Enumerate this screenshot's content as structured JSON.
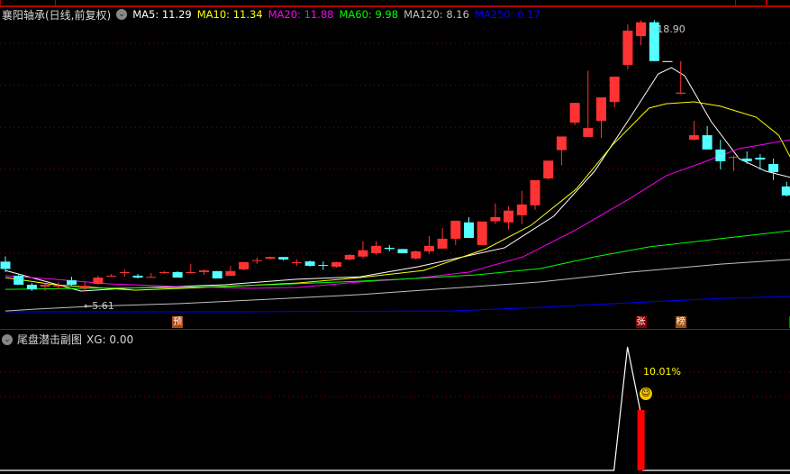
{
  "header": {
    "stock_title": "襄阳轴承(日线,前复权)",
    "ma_labels": [
      {
        "text": "MA5: 11.29",
        "color": "#ffffff"
      },
      {
        "text": "MA10: 11.34",
        "color": "#ffff00"
      },
      {
        "text": "MA20: 11.88",
        "color": "#ff00ff"
      },
      {
        "text": "MA60: 9.98",
        "color": "#00ff00"
      },
      {
        "text": "MA120: 8.16",
        "color": "#c0c0c0"
      },
      {
        "text": "MA250: 6.17",
        "color": "#0000ff"
      }
    ]
  },
  "main_chart": {
    "high_label": "18.90",
    "low_label": "5.61",
    "grid_prices": [
      18,
      16,
      14,
      12,
      10,
      8
    ],
    "price_range": [
      5.0,
      18.9
    ],
    "up_color": "#ff3333",
    "down_color": "#54ffff",
    "candles": [
      [
        7.6,
        7.25,
        7.85,
        7.1
      ],
      [
        6.93,
        6.5,
        7.01,
        6.5
      ],
      [
        6.5,
        6.28,
        6.58,
        6.2
      ],
      [
        6.41,
        6.5,
        6.58,
        6.2
      ],
      [
        6.45,
        6.45,
        6.62,
        6.28
      ],
      [
        6.71,
        6.5,
        6.88,
        6.45
      ],
      [
        6.33,
        6.45,
        6.62,
        6.2
      ],
      [
        6.54,
        6.84,
        6.93,
        6.5
      ],
      [
        6.9,
        6.93,
        7.01,
        6.88
      ],
      [
        7.08,
        7.1,
        7.23,
        6.88
      ],
      [
        6.93,
        6.84,
        7.01,
        6.8
      ],
      [
        6.85,
        6.87,
        7.06,
        6.84
      ],
      [
        7.06,
        7.1,
        7.15,
        7.01
      ],
      [
        7.1,
        6.84,
        7.15,
        6.84
      ],
      [
        7.06,
        7.1,
        7.49,
        7.01
      ],
      [
        7.1,
        7.18,
        7.23,
        6.97
      ],
      [
        7.15,
        6.8,
        7.15,
        6.8
      ],
      [
        6.93,
        7.15,
        7.4,
        6.93
      ],
      [
        7.23,
        7.58,
        7.58,
        7.19
      ],
      [
        7.65,
        7.67,
        7.8,
        7.49
      ],
      [
        7.74,
        7.82,
        7.84,
        7.7
      ],
      [
        7.82,
        7.7,
        7.82,
        7.65
      ],
      [
        7.55,
        7.57,
        7.7,
        7.4
      ],
      [
        7.61,
        7.4,
        7.65,
        7.36
      ],
      [
        7.44,
        7.42,
        7.62,
        7.2
      ],
      [
        7.36,
        7.57,
        7.6,
        7.32
      ],
      [
        7.7,
        7.92,
        7.95,
        7.66
      ],
      [
        7.84,
        8.14,
        8.57,
        7.75
      ],
      [
        8.0,
        8.35,
        8.57,
        7.92
      ],
      [
        8.26,
        8.2,
        8.39,
        8.09
      ],
      [
        8.2,
        8.0,
        8.2,
        8.0
      ],
      [
        7.75,
        8.09,
        8.13,
        7.7
      ],
      [
        8.09,
        8.35,
        8.82,
        7.97
      ],
      [
        8.22,
        8.69,
        9.2,
        8.22
      ],
      [
        8.69,
        9.55,
        9.55,
        8.39
      ],
      [
        9.47,
        8.73,
        9.72,
        8.73
      ],
      [
        8.39,
        9.51,
        9.51,
        8.39
      ],
      [
        9.52,
        9.72,
        10.37,
        9.39
      ],
      [
        9.47,
        10.03,
        10.24,
        9.13
      ],
      [
        9.81,
        10.32,
        10.97,
        9.39
      ],
      [
        10.28,
        11.48,
        11.48,
        10.07
      ],
      [
        11.56,
        12.41,
        12.41,
        11.5
      ],
      [
        12.91,
        13.56,
        13.56,
        12.19
      ],
      [
        14.22,
        15.16,
        15.16,
        14.1
      ],
      [
        13.54,
        13.96,
        16.69,
        13.54
      ],
      [
        14.3,
        15.42,
        15.42,
        13.49
      ],
      [
        15.2,
        16.41,
        16.41,
        14.96
      ],
      [
        16.97,
        18.6,
        18.9,
        16.75
      ],
      [
        18.34,
        19.0,
        19.1,
        17.9
      ],
      [
        19.0,
        17.15,
        19.1,
        17.15
      ],
      [
        17.15,
        17.15,
        17.15,
        17.15
      ],
      [
        15.6,
        15.65,
        17.15,
        15.6
      ],
      [
        13.41,
        13.62,
        14.3,
        13.37
      ],
      [
        13.62,
        12.94,
        14.05,
        12.94
      ],
      [
        12.94,
        12.38,
        13.4,
        12.0
      ],
      [
        12.59,
        12.59,
        12.65,
        11.91
      ],
      [
        12.51,
        12.38,
        12.85,
        12.25
      ],
      [
        12.55,
        12.46,
        12.72,
        11.97
      ],
      [
        12.25,
        11.86,
        12.51,
        11.48
      ],
      [
        11.18,
        10.75,
        11.4,
        10.7
      ]
    ],
    "ma_series": [
      {
        "name": "MA5",
        "color": "#ffffff",
        "points": [
          [
            0,
            7.18
          ],
          [
            5.7,
            6.2
          ],
          [
            9.1,
            6.33
          ],
          [
            16.6,
            6.5
          ],
          [
            22,
            6.76
          ],
          [
            26.8,
            6.88
          ],
          [
            31.2,
            7.36
          ],
          [
            34.3,
            7.79
          ],
          [
            37.7,
            8.26
          ],
          [
            41.4,
            9.76
          ],
          [
            44.5,
            11.91
          ],
          [
            47.2,
            14.48
          ],
          [
            49.3,
            16.54
          ],
          [
            50.3,
            16.84
          ],
          [
            51.3,
            16.45
          ],
          [
            53.3,
            14.27
          ],
          [
            55.4,
            12.51
          ],
          [
            57.4,
            11.91
          ],
          [
            59.3,
            11.61
          ]
        ]
      },
      {
        "name": "MA10",
        "color": "#ffff00",
        "points": [
          [
            0,
            6.84
          ],
          [
            3.7,
            6.5
          ],
          [
            9.8,
            6.24
          ],
          [
            16.6,
            6.41
          ],
          [
            22,
            6.58
          ],
          [
            26.8,
            6.84
          ],
          [
            31.6,
            7.18
          ],
          [
            36.3,
            8.21
          ],
          [
            39.7,
            9.33
          ],
          [
            43.1,
            11.05
          ],
          [
            45.9,
            13.19
          ],
          [
            48.6,
            14.91
          ],
          [
            49.9,
            15.12
          ],
          [
            52,
            15.21
          ],
          [
            54,
            15.0
          ],
          [
            56.7,
            14.48
          ],
          [
            58.4,
            13.62
          ],
          [
            59.3,
            12.55
          ]
        ]
      },
      {
        "name": "MA20",
        "color": "#ff00ff",
        "points": [
          [
            0,
            6.93
          ],
          [
            3.7,
            6.76
          ],
          [
            7.8,
            6.54
          ],
          [
            13.2,
            6.41
          ],
          [
            18.6,
            6.33
          ],
          [
            22,
            6.37
          ],
          [
            26.8,
            6.63
          ],
          [
            30.9,
            6.8
          ],
          [
            35,
            7.1
          ],
          [
            39.1,
            7.83
          ],
          [
            43.1,
            9.12
          ],
          [
            47.2,
            10.62
          ],
          [
            49.9,
            11.69
          ],
          [
            52.7,
            12.33
          ],
          [
            55.4,
            12.98
          ],
          [
            59.3,
            13.41
          ]
        ]
      },
      {
        "name": "MA60",
        "color": "#00ff00",
        "points": [
          [
            0,
            6.28
          ],
          [
            6.4,
            6.33
          ],
          [
            13.2,
            6.37
          ],
          [
            20,
            6.5
          ],
          [
            26.8,
            6.67
          ],
          [
            30.9,
            6.8
          ],
          [
            35.6,
            6.97
          ],
          [
            40.4,
            7.27
          ],
          [
            44.5,
            7.83
          ],
          [
            48.6,
            8.3
          ],
          [
            54,
            8.69
          ],
          [
            59.3,
            9.07
          ]
        ]
      },
      {
        "name": "MA120",
        "color": "#c0c0c0",
        "points": [
          [
            0,
            5.25
          ],
          [
            2.3,
            5.34
          ],
          [
            6.4,
            5.47
          ],
          [
            13.2,
            5.6
          ],
          [
            20,
            5.81
          ],
          [
            26.8,
            6.03
          ],
          [
            33.6,
            6.33
          ],
          [
            40.4,
            6.63
          ],
          [
            47.2,
            7.1
          ],
          [
            54,
            7.48
          ],
          [
            59.3,
            7.7
          ]
        ]
      },
      {
        "name": "MA250",
        "color": "#0000ff",
        "points": [
          [
            0,
            5.21
          ],
          [
            16.6,
            5.21
          ],
          [
            33.6,
            5.25
          ],
          [
            40.4,
            5.42
          ],
          [
            47.2,
            5.64
          ],
          [
            54,
            5.85
          ],
          [
            59.3,
            5.94
          ]
        ]
      }
    ],
    "markers": [
      {
        "text": "预",
        "index": 13,
        "color": "#b5460f"
      },
      {
        "text": "张",
        "index": 48,
        "color": "#8b0000"
      },
      {
        "text": "榜",
        "index": 51,
        "color": "#a0500a"
      },
      {
        "text": "疑",
        "index": 59.6,
        "color": "#008000"
      }
    ]
  },
  "sub_chart": {
    "title": "尾盘潜击副图",
    "xg_label": "XG: 0.00",
    "signal_pct": "10.01%",
    "signal_index": 48,
    "smile_icon": "smiley-face-icon"
  }
}
